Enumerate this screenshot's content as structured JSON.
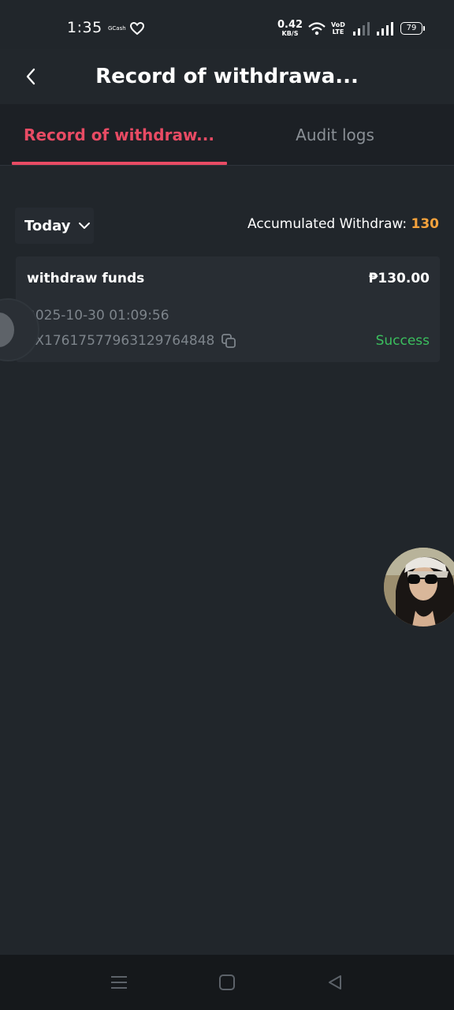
{
  "status_bar": {
    "time": "1:35",
    "gcash_label": "GCash",
    "net_speed_value": "0.42",
    "net_speed_unit": "KB/S",
    "volte_line1": "VoD",
    "volte_line2": "LTE",
    "battery": "79"
  },
  "header": {
    "title": "Record of withdrawa..."
  },
  "tabs": [
    {
      "label": "Record of withdraw...",
      "active": true
    },
    {
      "label": "Audit logs",
      "active": false
    }
  ],
  "filter": {
    "date_label": "Today",
    "accumulated_label": "Accumulated Withdraw: ",
    "accumulated_value": "130"
  },
  "records": [
    {
      "title": "withdraw funds",
      "amount": "₱130.00",
      "datetime": "2025-10-30 01:09:56",
      "txid": "TX17617577963129764848",
      "status": "Success"
    }
  ],
  "colors": {
    "accent": "#e84b64",
    "accumulated": "#f5a23c",
    "success": "#3bbf5e",
    "background": "#21262b"
  },
  "icons": {
    "back": "chevron-left-icon",
    "dropdown": "chevron-down-icon",
    "copy": "copy-icon",
    "nav_menu": "menu-icon",
    "nav_home": "home-square-icon",
    "nav_back": "triangle-back-icon"
  }
}
